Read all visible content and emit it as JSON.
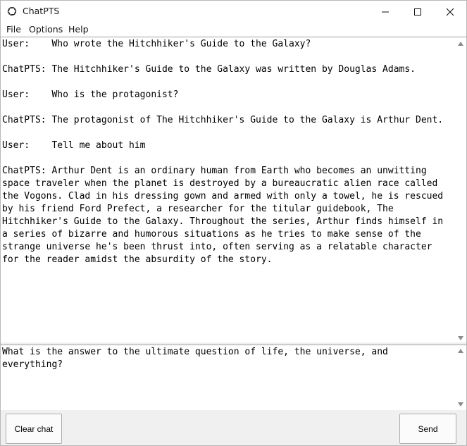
{
  "window": {
    "title": "ChatPTS"
  },
  "menu": {
    "items": [
      "File",
      "Options",
      "Help"
    ]
  },
  "chat": {
    "transcript": "User:    Who wrote the Hitchhiker's Guide to the Galaxy?\n\nChatPTS: The Hitchhiker's Guide to the Galaxy was written by Douglas Adams.\n\nUser:    Who is the protagonist?\n\nChatPTS: The protagonist of The Hitchhiker's Guide to the Galaxy is Arthur Dent.\n\nUser:    Tell me about him\n\nChatPTS: Arthur Dent is an ordinary human from Earth who becomes an unwitting\nspace traveler when the planet is destroyed by a bureaucratic alien race called\nthe Vogons. Clad in his dressing gown and armed with only a towel, he is rescued\nby his friend Ford Prefect, a researcher for the titular guidebook, The\nHitchhiker's Guide to the Galaxy. Throughout the series, Arthur finds himself in\na series of bizarre and humorous situations as he tries to make sense of the\nstrange universe he's been thrust into, often serving as a relatable character\nfor the reader amidst the absurdity of the story."
  },
  "input": {
    "value": "What is the answer to the ultimate question of life, the universe, and\neverything?"
  },
  "buttons": {
    "clear": "Clear chat",
    "send": "Send"
  },
  "icons": {
    "app": "openai-logo-icon",
    "minimize": "minimize-icon",
    "maximize": "maximize-icon",
    "close": "close-icon"
  }
}
